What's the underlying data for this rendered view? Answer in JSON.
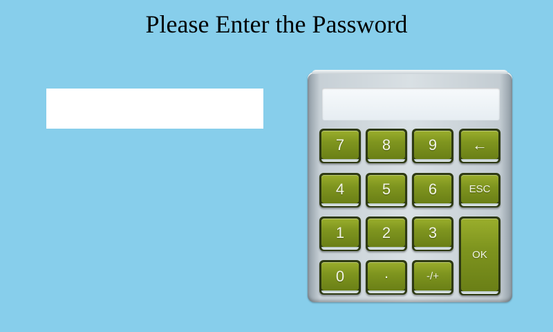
{
  "page": {
    "title": "Please Enter the Password"
  },
  "password_field": {
    "value": "",
    "placeholder": ""
  },
  "keypad": {
    "display_value": "",
    "keys": {
      "k7": "7",
      "k8": "8",
      "k9": "9",
      "backspace": "←",
      "k4": "4",
      "k5": "5",
      "k6": "6",
      "esc": "ESC",
      "k1": "1",
      "k2": "2",
      "k3": "3",
      "ok": "OK",
      "k0": "0",
      "dot": "·",
      "sign": "-/+"
    },
    "colors": {
      "background": "#87ceeb",
      "key_green": "#7f951f",
      "body_silver": "#d9e0e4"
    }
  }
}
